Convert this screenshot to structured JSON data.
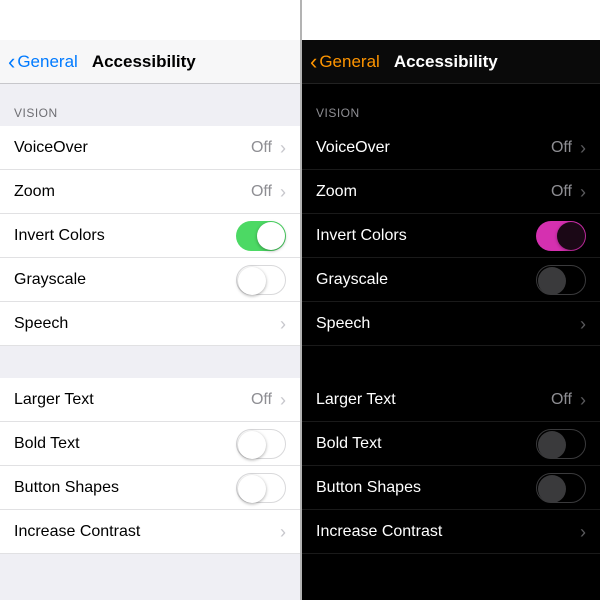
{
  "nav": {
    "back": "General",
    "title": "Accessibility"
  },
  "section": {
    "vision": "VISION"
  },
  "rows": {
    "voiceover": {
      "label": "VoiceOver",
      "value": "Off"
    },
    "zoom": {
      "label": "Zoom",
      "value": "Off"
    },
    "invert": {
      "label": "Invert Colors"
    },
    "grayscale": {
      "label": "Grayscale"
    },
    "speech": {
      "label": "Speech"
    },
    "largertext": {
      "label": "Larger Text",
      "value": "Off"
    },
    "boldtext": {
      "label": "Bold Text"
    },
    "buttonshapes": {
      "label": "Button Shapes"
    },
    "contrast": {
      "label": "Increase Contrast"
    }
  }
}
